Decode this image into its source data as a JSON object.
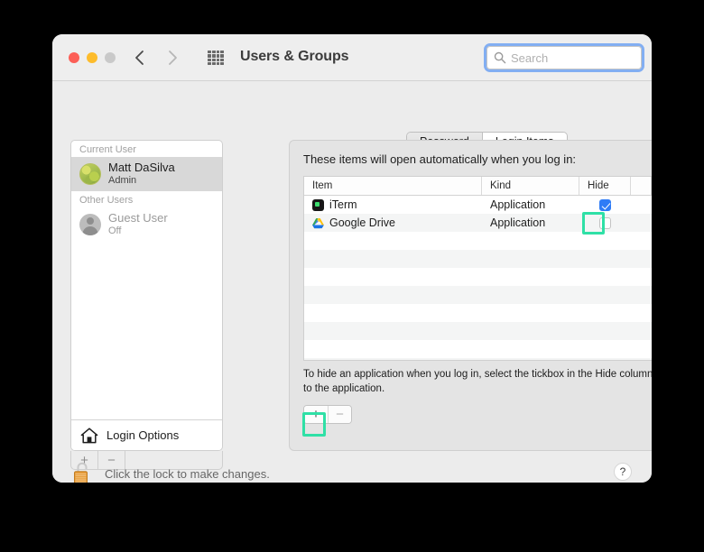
{
  "window": {
    "title": "Users & Groups",
    "traffic_lights": [
      "close",
      "minimize",
      "maximize"
    ],
    "back_label": "‹",
    "forward_label": "›"
  },
  "search": {
    "placeholder": "Search",
    "value": ""
  },
  "sidebar": {
    "sections": [
      {
        "header": "Current User",
        "users": [
          {
            "name": "Matt DaSilva",
            "sub": "Admin",
            "selected": true,
            "avatar": "photo-avatar"
          }
        ]
      },
      {
        "header": "Other Users",
        "users": [
          {
            "name": "Guest User",
            "sub": "Off",
            "selected": false,
            "avatar": "person-avatar"
          }
        ]
      }
    ],
    "login_options_label": "Login Options",
    "toolbar": {
      "add_label": "+",
      "remove_label": "−"
    }
  },
  "tabs": [
    {
      "label": "Password",
      "active": false
    },
    {
      "label": "Login Items",
      "active": true
    }
  ],
  "panel": {
    "description": "These items will open automatically when you log in:",
    "note": "To hide an application when you log in, select the tickbox in the Hide column next to the application.",
    "add_label": "+",
    "remove_label": "−"
  },
  "table": {
    "columns": [
      "Item",
      "Kind",
      "Hide"
    ],
    "rows": [
      {
        "item": "iTerm",
        "kind": "Application",
        "hide": true,
        "icon": "iterm-icon"
      },
      {
        "item": "Google Drive",
        "kind": "Application",
        "hide": false,
        "icon": "google-drive-icon"
      }
    ],
    "empty_row_count": 8
  },
  "footer": {
    "lock_text": "Click the lock to make changes.",
    "lock_state": "unlocked",
    "help_label": "?"
  },
  "highlights": {
    "color": "#2fe0a6",
    "targets": [
      "hide-checkbox-iterm",
      "add-login-item-button"
    ]
  }
}
